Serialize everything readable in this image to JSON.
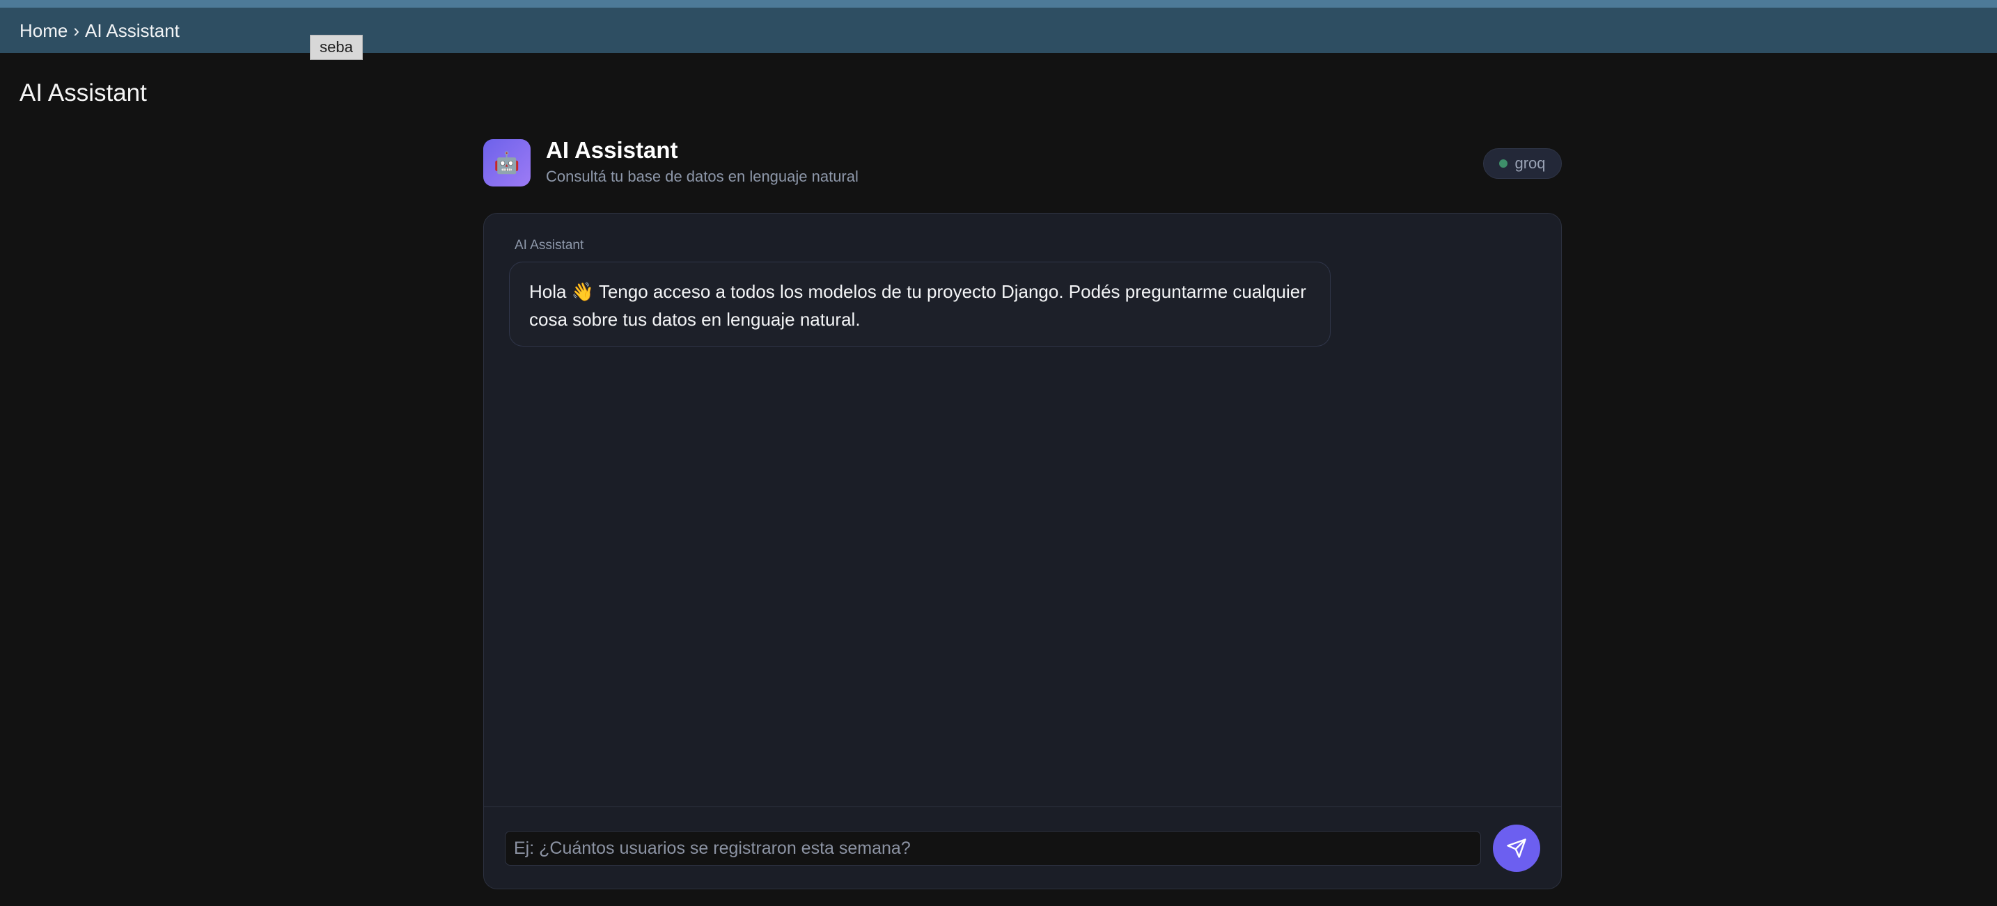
{
  "breadcrumb": {
    "home": "Home",
    "separator": "›",
    "current": "AI Assistant"
  },
  "tooltip": "seba",
  "page": {
    "title": "AI Assistant"
  },
  "assistant": {
    "icon": "robot-icon",
    "title": "AI Assistant",
    "subtitle": "Consultá tu base de datos en lenguaje natural",
    "provider": "groq"
  },
  "chat": {
    "messages": [
      {
        "sender": "AI Assistant",
        "text_before_emoji": "Hola ",
        "emoji": "👋",
        "text_after_emoji": " Tengo acceso a todos los modelos de tu proyecto Django. Podés preguntarme cualquier cosa sobre tus datos en lenguaje natural."
      }
    ],
    "input": {
      "placeholder": "Ej: ¿Cuántos usuarios se registraron esta semana?",
      "value": ""
    },
    "send_icon": "send-icon"
  },
  "colors": {
    "accent": "#6c5ff0",
    "header_bar": "#2e4e62",
    "background": "#121212",
    "card": "#1b1e27",
    "status_dot": "#3e8f6a"
  }
}
